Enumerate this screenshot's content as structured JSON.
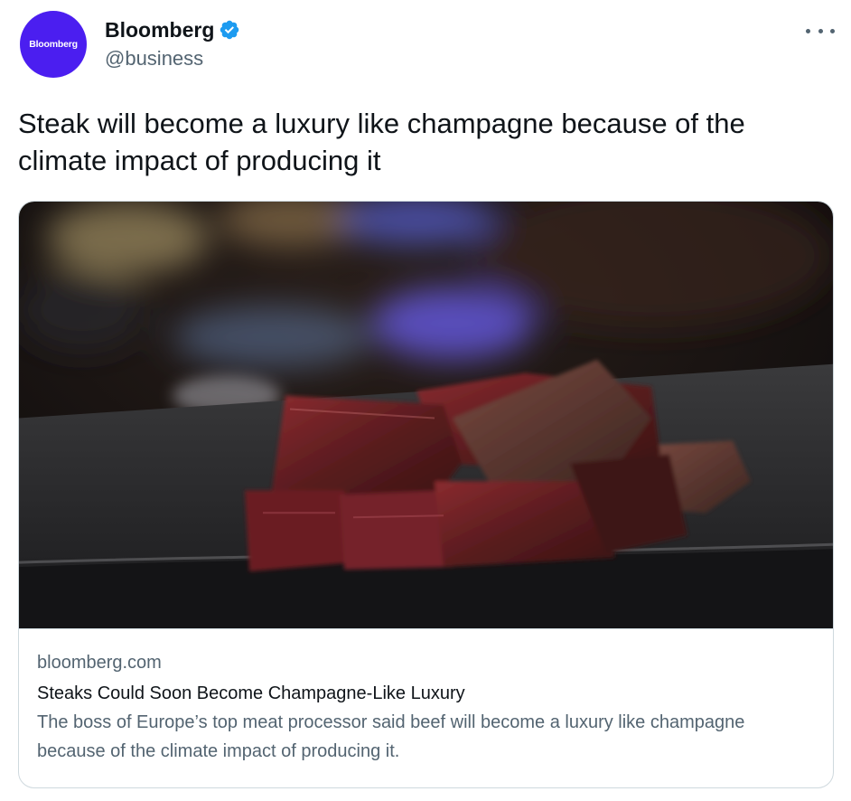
{
  "author": {
    "name": "Bloomberg",
    "handle": "@business",
    "avatar_text": "Bloomberg",
    "avatar_color": "#4b1ef0",
    "verified": true
  },
  "tweet": {
    "text": "Steak will become a luxury like champagne because of the climate impact of producing it"
  },
  "card": {
    "domain": "bloomberg.com",
    "title": "Steaks Could Soon Become Champagne-Like Luxury",
    "description": "The boss of Europe’s top meat processor said beef will become a luxury like champagne because of the climate impact of producing it.",
    "image": "steak-slices-on-dark-plate-photo"
  },
  "icons": {
    "verified": "verified-badge-icon",
    "more": "more-options-icon"
  },
  "colors": {
    "verified_blue": "#1d9bf0",
    "secondary_text": "#536471",
    "border": "#cfd9de"
  }
}
